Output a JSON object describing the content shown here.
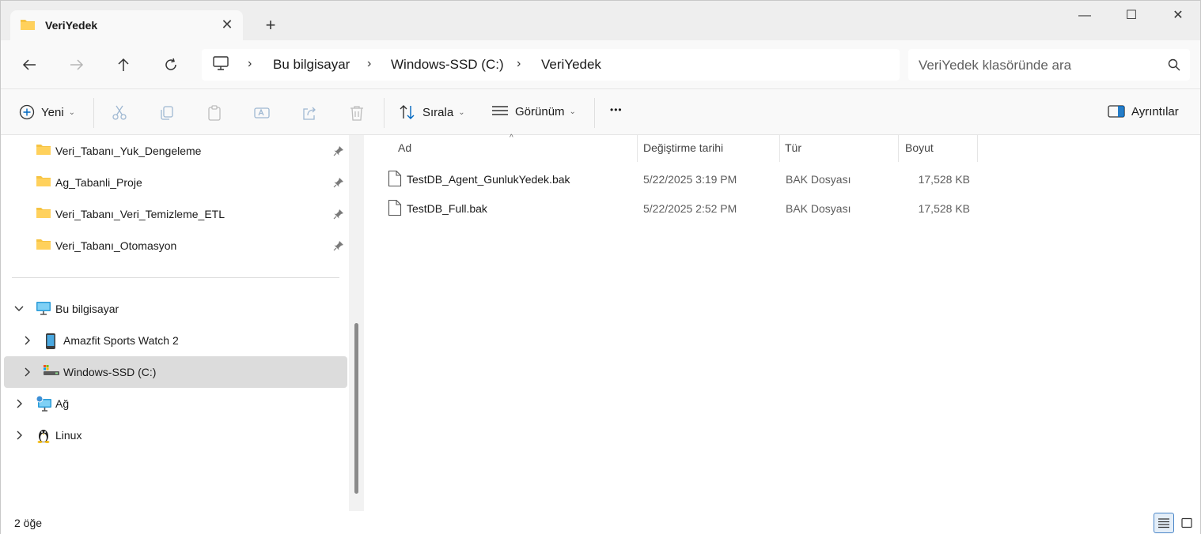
{
  "window": {
    "tab_title": "VeriYedek",
    "tab_close_glyph": "✕",
    "new_tab_glyph": "+",
    "minimize_glyph": "—",
    "maximize_glyph": "☐",
    "close_glyph": "✕"
  },
  "nav": {
    "breadcrumb": [
      "Bu bilgisayar",
      "Windows-SSD (C:)",
      "VeriYedek"
    ],
    "breadcrumb_sep": "›",
    "search_placeholder": "VeriYedek klasöründe ara"
  },
  "commands": {
    "new_label": "Yeni",
    "sort_label": "Sırala",
    "view_label": "Görünüm",
    "more_glyph": "•••",
    "details_label": "Ayrıntılar",
    "chevron_glyph": "⌄"
  },
  "sidebar": {
    "pinned": [
      {
        "label": "Veri_Tabanı_Yuk_Dengeleme"
      },
      {
        "label": "Ag_Tabanli_Proje"
      },
      {
        "label": "Veri_Tabanı_Veri_Temizleme_ETL"
      },
      {
        "label": "Veri_Tabanı_Otomasyon"
      }
    ],
    "tree": [
      {
        "label": "Bu bilgisayar",
        "icon": "computer-icon",
        "expanded": true
      },
      {
        "label": "Amazfit Sports Watch 2",
        "icon": "phone-device-icon"
      },
      {
        "label": "Windows-SSD (C:)",
        "icon": "drive-icon",
        "selected": true
      },
      {
        "label": "Ağ",
        "icon": "network-icon"
      },
      {
        "label": "Linux",
        "icon": "linux-penguin-icon"
      }
    ]
  },
  "files": {
    "columns": {
      "name": "Ad",
      "modified": "Değiştirme tarihi",
      "type": "Tür",
      "size": "Boyut"
    },
    "sort_caret": "^",
    "rows": [
      {
        "name": "TestDB_Agent_GunlukYedek.bak",
        "modified": "5/22/2025 3:19 PM",
        "type": "BAK Dosyası",
        "size": "17,528 KB"
      },
      {
        "name": "TestDB_Full.bak",
        "modified": "5/22/2025 2:52 PM",
        "type": "BAK Dosyası",
        "size": "17,528 KB"
      }
    ]
  },
  "status": {
    "count_text": "2 öğe"
  },
  "colors": {
    "accent": "#0067c0",
    "folder": "#f6c342",
    "selected_bg": "#dcdcdc"
  }
}
